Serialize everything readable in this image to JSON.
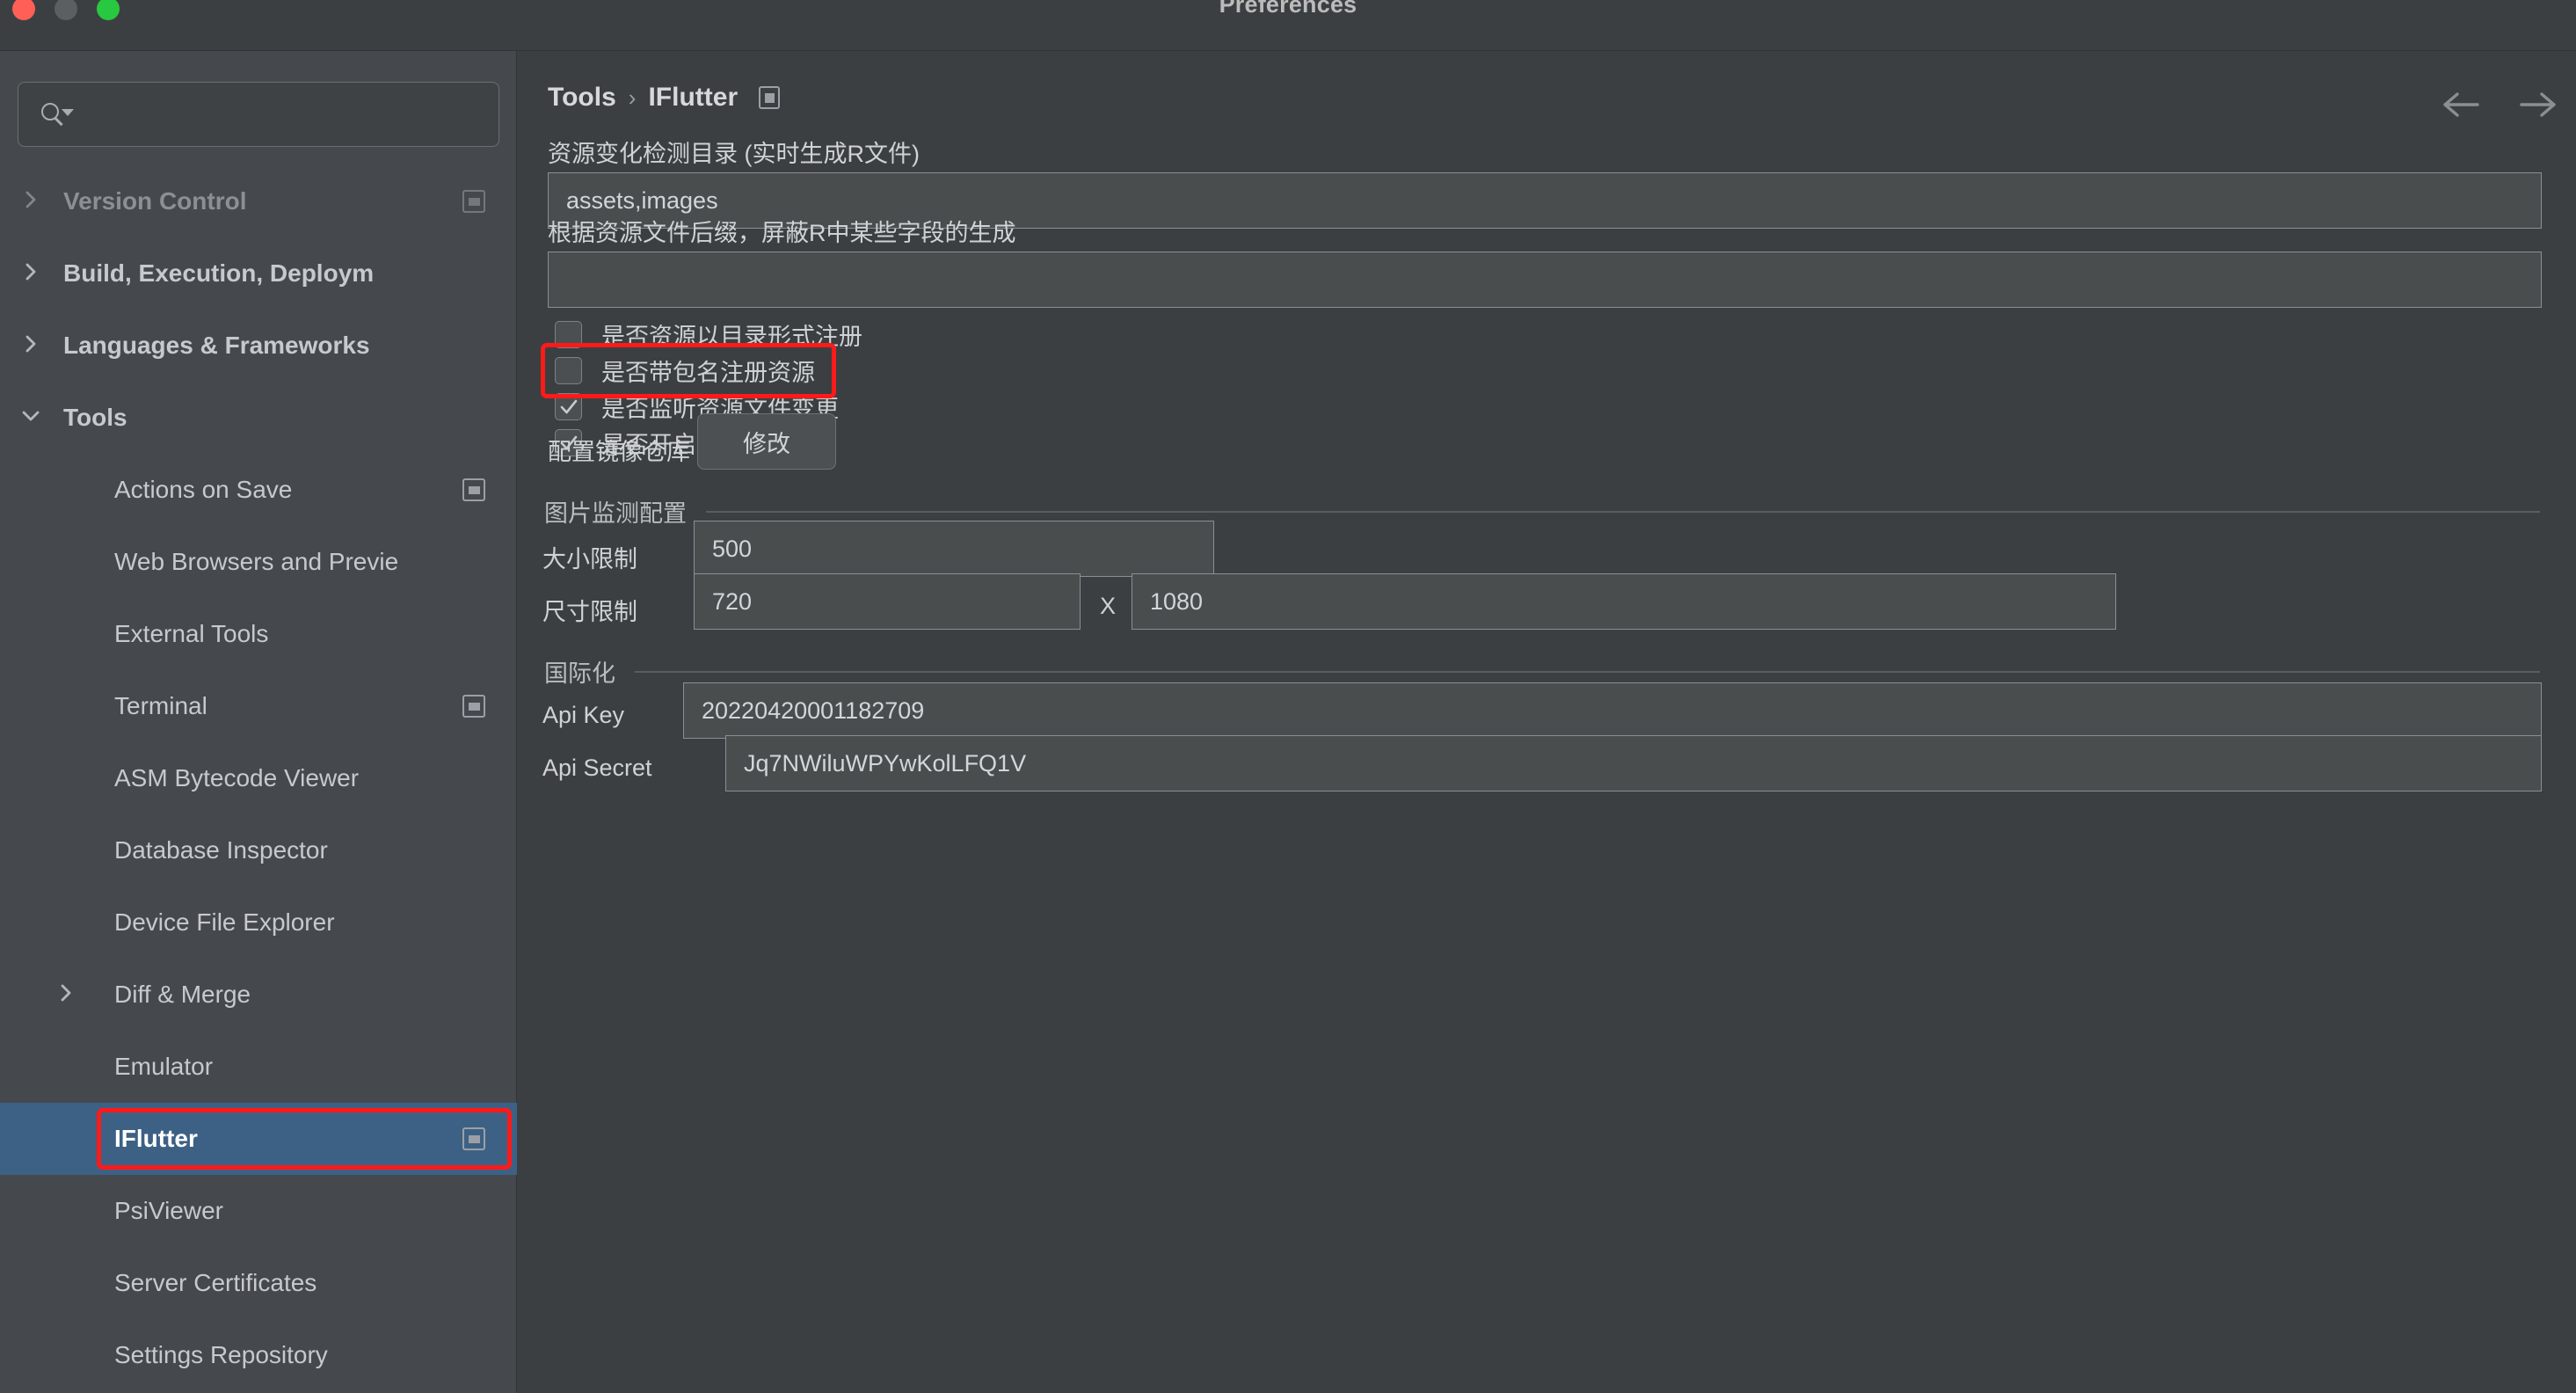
{
  "window": {
    "title": "Preferences",
    "traffic_lights": [
      "close-red",
      "minimize-yellow",
      "zoom-green"
    ]
  },
  "sidebar": {
    "search": {
      "value": "",
      "placeholder": ""
    },
    "items": [
      {
        "label": "Version Control",
        "level": 0,
        "chevron": "right",
        "cfg_icon": true,
        "selected": false,
        "faded": true
      },
      {
        "label": "Build, Execution, Deploym",
        "level": 0,
        "chevron": "right",
        "cfg_icon": false,
        "selected": false,
        "faded": false
      },
      {
        "label": "Languages & Frameworks",
        "level": 0,
        "chevron": "right",
        "cfg_icon": false,
        "selected": false,
        "faded": false
      },
      {
        "label": "Tools",
        "level": 0,
        "chevron": "down",
        "cfg_icon": false,
        "selected": false,
        "faded": false
      },
      {
        "label": "Actions on Save",
        "level": 1,
        "chevron": "none",
        "cfg_icon": true,
        "selected": false,
        "faded": false
      },
      {
        "label": "Web Browsers and Previe",
        "level": 1,
        "chevron": "none",
        "cfg_icon": false,
        "selected": false,
        "faded": false
      },
      {
        "label": "External Tools",
        "level": 1,
        "chevron": "none",
        "cfg_icon": false,
        "selected": false,
        "faded": false
      },
      {
        "label": "Terminal",
        "level": 1,
        "chevron": "none",
        "cfg_icon": true,
        "selected": false,
        "faded": false
      },
      {
        "label": "ASM Bytecode Viewer",
        "level": 1,
        "chevron": "none",
        "cfg_icon": false,
        "selected": false,
        "faded": false
      },
      {
        "label": "Database Inspector",
        "level": 1,
        "chevron": "none",
        "cfg_icon": false,
        "selected": false,
        "faded": false
      },
      {
        "label": "Device File Explorer",
        "level": 1,
        "chevron": "none",
        "cfg_icon": false,
        "selected": false,
        "faded": false
      },
      {
        "label": "Diff & Merge",
        "level": 1,
        "chevron": "right",
        "cfg_icon": false,
        "selected": false,
        "faded": false
      },
      {
        "label": "Emulator",
        "level": 1,
        "chevron": "none",
        "cfg_icon": false,
        "selected": false,
        "faded": false
      },
      {
        "label": "IFlutter",
        "level": 1,
        "chevron": "none",
        "cfg_icon": true,
        "selected": true,
        "faded": false
      },
      {
        "label": "PsiViewer",
        "level": 1,
        "chevron": "none",
        "cfg_icon": false,
        "selected": false,
        "faded": false
      },
      {
        "label": "Server Certificates",
        "level": 1,
        "chevron": "none",
        "cfg_icon": false,
        "selected": false,
        "faded": false
      },
      {
        "label": "Settings Repository",
        "level": 1,
        "chevron": "none",
        "cfg_icon": false,
        "selected": false,
        "faded": false
      }
    ]
  },
  "main": {
    "breadcrumb": {
      "root": "Tools",
      "separator": "›",
      "leaf": "IFlutter"
    },
    "nav": {
      "back": "back-arrow",
      "forward": "forward-arrow"
    },
    "res_dir": {
      "label": "资源变化检测目录 (实时生成R文件)",
      "value": "assets,images",
      "placeholder": ""
    },
    "res_suffix": {
      "label": "根据资源文件后缀，屏蔽R中某些字段的生成",
      "value": "",
      "placeholder": ""
    },
    "checkboxes": [
      {
        "label": "是否资源以目录形式注册",
        "checked": false,
        "highlighted": false
      },
      {
        "label": "是否带包名注册资源",
        "checked": false,
        "highlighted": true
      },
      {
        "label": "是否监听资源文件变更",
        "checked": true,
        "highlighted": false
      },
      {
        "label": "是否开启Flutter2.0",
        "checked": true,
        "highlighted": false
      }
    ],
    "mirror": {
      "label": "配置镜像仓库",
      "button": "修改"
    },
    "image_section": {
      "title": "图片监测配置",
      "size_limit": {
        "label": "大小限制",
        "value": "500"
      },
      "dimension": {
        "label": "尺寸限制",
        "width": "720",
        "separator": "X",
        "height": "1080"
      }
    },
    "i18n_section": {
      "title": "国际化",
      "api_key": {
        "label": "Api Key",
        "value": "20220420001182709"
      },
      "api_secret": {
        "label": "Api Secret",
        "value": "Jq7NWiluWPYwKolLFQ1V"
      }
    }
  },
  "annotations": {
    "accent_color": "#ff1a1a",
    "selection_color": "#3d6185",
    "regions": [
      "iflutter-sidebar-item",
      "package-name-checkbox-row"
    ]
  }
}
